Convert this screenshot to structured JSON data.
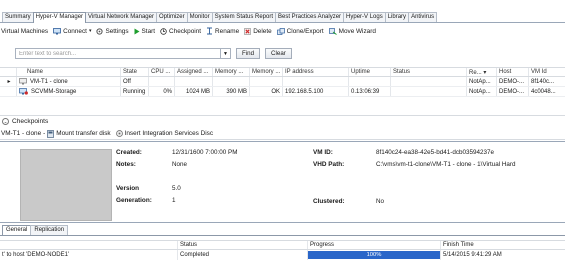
{
  "top_tabs": [
    {
      "label": "Summary",
      "active": false
    },
    {
      "label": "Hyper-V Manager",
      "active": true
    },
    {
      "label": "Virtual Network Manager",
      "active": false
    },
    {
      "label": "Optimizer",
      "active": false
    },
    {
      "label": "Monitor",
      "active": false
    },
    {
      "label": "System Status Report",
      "active": false
    },
    {
      "label": "Best Practices Analyzer",
      "active": false
    },
    {
      "label": "Hyper-V Logs",
      "active": false
    },
    {
      "label": "Library",
      "active": false
    },
    {
      "label": "Antivirus",
      "active": false
    }
  ],
  "toolbar": {
    "title": "Virtual Machines",
    "connect": "Connect",
    "settings": "Settings",
    "start": "Start",
    "checkpoint": "Checkpoint",
    "rename": "Rename",
    "delete": "Delete",
    "clone_export": "Clone/Export",
    "move_wizard": "Move Wizard"
  },
  "search": {
    "placeholder": "Enter text to search...",
    "find_label": "Find",
    "clear_label": "Clear"
  },
  "grid": {
    "columns": [
      "Name",
      "State",
      "CPU ...",
      "Assigned ...",
      "Memory ...",
      "Memory ...",
      "IP address",
      "Uptime",
      "Status",
      "Re... ▾",
      "Host",
      "VM Id"
    ],
    "rows": [
      {
        "name": "VM-T1 - clone",
        "state": "Off",
        "cpu": "",
        "assigned": "",
        "memory": "",
        "memory2": "",
        "ip": "",
        "uptime": "",
        "status": "",
        "re": "NotAp...",
        "host": "DEMO-...",
        "vmid": "8f140c..."
      },
      {
        "name": "SCVMM-Storage",
        "state": "Running",
        "cpu": "0%",
        "assigned": "1024 MB",
        "memory": "390 MB",
        "memory2": "OK",
        "ip": "192.168.5.100",
        "uptime": "0.13:06:39",
        "status": "",
        "re": "NotAp...",
        "host": "DEMO-...",
        "vmid": "4c0048..."
      }
    ]
  },
  "checkpoints": {
    "header": "Checkpoints",
    "vm_name": "VM-T1 - clone",
    "mount": "Mount transfer disk",
    "insert": "Insert Integration Services Disc"
  },
  "details": {
    "created_label": "Created:",
    "created_value": "12/31/1600 7:00:00 PM",
    "notes_label": "Notes:",
    "notes_value": "None",
    "version_label": "Version",
    "version_value": "5.0",
    "generation_label": "Generation:",
    "generation_value": "1",
    "vmid_label": "VM ID:",
    "vmid_value": "8f140c24-ea38-42e5-bd41-dcb03594237e",
    "vhd_label": "VHD Path:",
    "vhd_value": "C:\\vms\\vm-t1-clone\\VM-T1 - clone - 1\\Virtual Hard",
    "clustered_label": "Clustered:",
    "clustered_value": "No"
  },
  "bottom_tabs": [
    {
      "label": "General",
      "active": true
    },
    {
      "label": "Replication",
      "active": false
    }
  ],
  "jobs": {
    "columns": [
      "",
      "Status",
      "Progress",
      "Finish Time"
    ],
    "rows": [
      {
        "name": "t' to host 'DEMO-NODE1'",
        "status": "Completed",
        "progress": 100,
        "progress_label": "100%",
        "finish": "5/14/2015 9:41:29 AM"
      }
    ]
  },
  "colors": {
    "accent": "#2a66c9",
    "green_start": "#1e9e2e",
    "red_delete": "#cf2a2a"
  }
}
